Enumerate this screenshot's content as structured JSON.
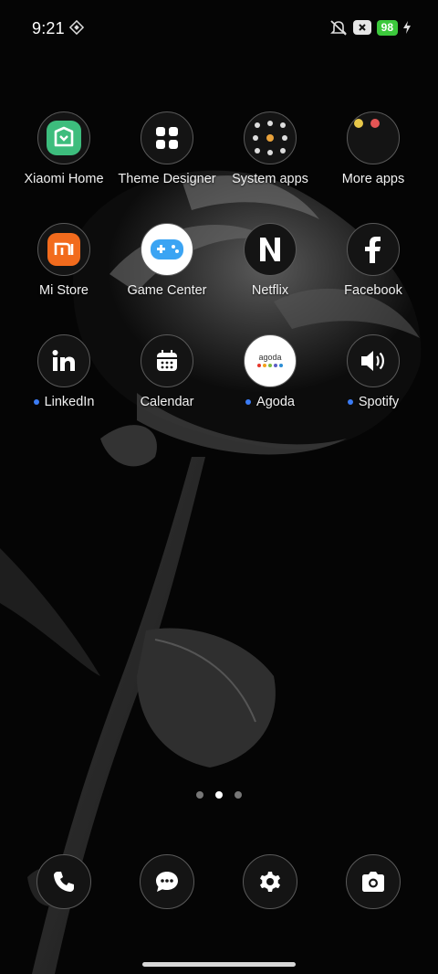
{
  "status": {
    "time": "9:21",
    "battery": "98"
  },
  "apps": [
    {
      "label": "Xiaomi Home",
      "icon": "xiaomi-home-icon"
    },
    {
      "label": "Theme Designer",
      "icon": "grid-icon"
    },
    {
      "label": "System apps",
      "icon": "folder-icon"
    },
    {
      "label": "More apps",
      "icon": "folder-icon"
    },
    {
      "label": "Mi Store",
      "icon": "mi-icon"
    },
    {
      "label": "Game Center",
      "icon": "gamepad-icon"
    },
    {
      "label": "Netflix",
      "icon": "netflix-icon"
    },
    {
      "label": "Facebook",
      "icon": "facebook-icon"
    },
    {
      "label": "LinkedIn",
      "icon": "linkedin-icon"
    },
    {
      "label": "Calendar",
      "icon": "calendar-icon"
    },
    {
      "label": "Agoda",
      "icon": "agoda-icon"
    },
    {
      "label": "Spotify",
      "icon": "speaker-icon"
    }
  ],
  "agoda_logo_text": "agoda",
  "mi_logo_text": "mi",
  "pager": {
    "pages": 3,
    "active": 2
  },
  "dock": [
    {
      "icon": "phone-icon"
    },
    {
      "icon": "messages-icon"
    },
    {
      "icon": "settings-icon"
    },
    {
      "icon": "camera-icon"
    }
  ],
  "colors": {
    "accent_dot": "#3b7cf5",
    "battery": "#3cc93c",
    "xiaomi_home": "#3dbd7d",
    "mi_store": "#f26b1d"
  }
}
